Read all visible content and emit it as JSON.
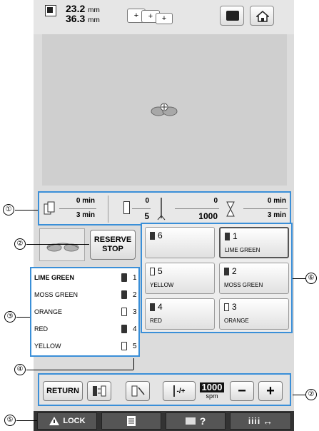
{
  "header": {
    "height_value": "23.2",
    "width_value": "36.3",
    "unit": "mm"
  },
  "status_strip": {
    "time_top_1": "0",
    "time_bottom_1": "3",
    "time_unit": "min",
    "color_top": "0",
    "color_bottom": "5",
    "stitch_top": "0",
    "stitch_bottom": "1000",
    "time_top_2": "0",
    "time_bottom_2": "3"
  },
  "reserve_stop": {
    "line1": "RESERVE",
    "line2": "STOP"
  },
  "thread_list": [
    {
      "name": "LIME GREEN",
      "num": "1"
    },
    {
      "name": "MOSS GREEN",
      "num": "2"
    },
    {
      "name": "ORANGE",
      "num": "3"
    },
    {
      "name": "RED",
      "num": "4"
    },
    {
      "name": "YELLOW",
      "num": "5"
    }
  ],
  "needle_grid": [
    {
      "num": "6",
      "label": ""
    },
    {
      "num": "1",
      "label": "LIME GREEN"
    },
    {
      "num": "5",
      "label": "YELLOW"
    },
    {
      "num": "2",
      "label": "MOSS GREEN"
    },
    {
      "num": "4",
      "label": "RED"
    },
    {
      "num": "3",
      "label": "ORANGE"
    }
  ],
  "toolbar": {
    "return_label": "RETURN",
    "needle_label": "-/+",
    "speed_value": "1000",
    "speed_unit": "spm",
    "minus": "−",
    "plus": "+"
  },
  "bottombar": {
    "lock_label": "LOCK",
    "help_label": "?"
  },
  "callouts": [
    "①",
    "②",
    "③",
    "④",
    "⑤",
    "⑥",
    "②"
  ],
  "colors": {
    "highlight": "#3a8fd8",
    "panel": "#dcdcdc"
  }
}
